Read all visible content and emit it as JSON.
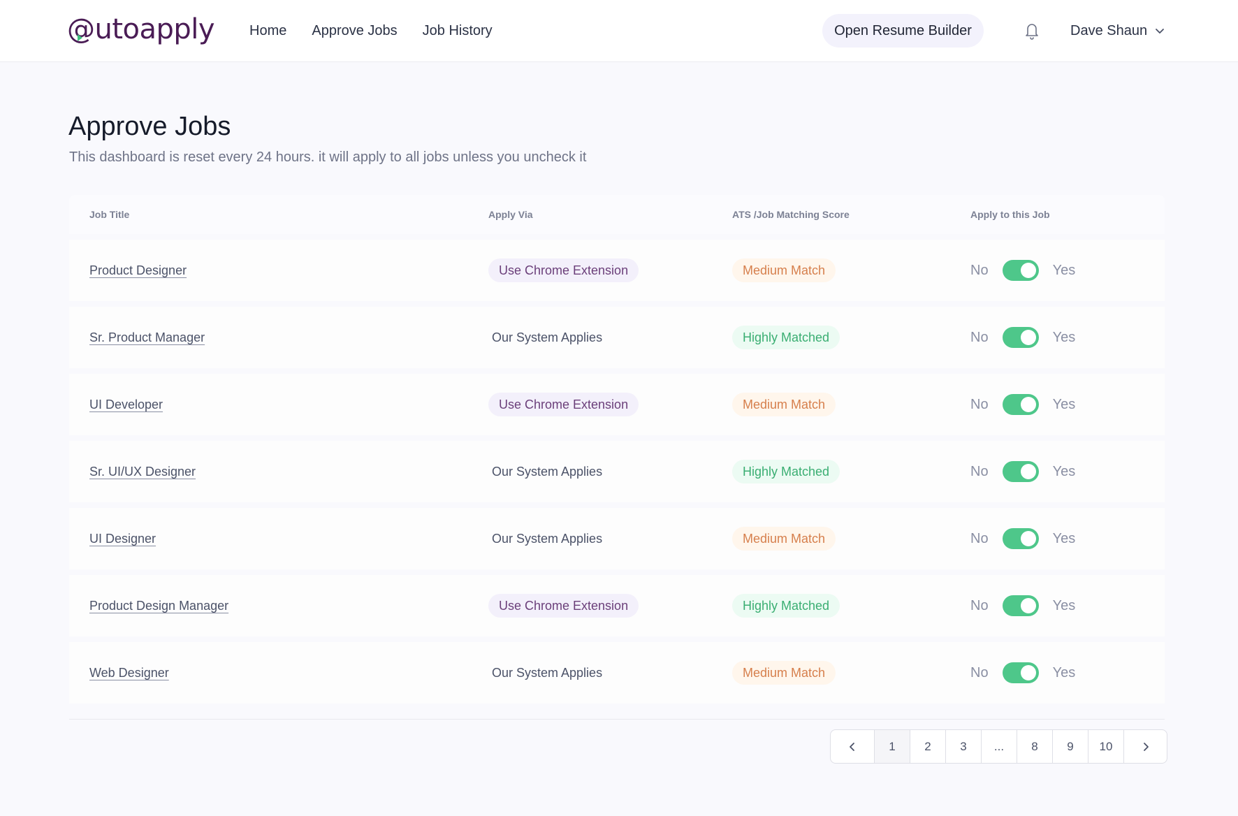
{
  "brand": {
    "logo_text": "@utoapply",
    "logo_color": "#4a1c55",
    "accent_color": "#3fbf7f"
  },
  "nav": {
    "items": [
      {
        "label": "Home"
      },
      {
        "label": "Approve Jobs"
      },
      {
        "label": "Job History"
      }
    ],
    "resume_button": "Open Resume Builder",
    "notification_icon": "bell-icon",
    "user_name": "Dave Shaun",
    "user_menu_icon": "chevron-down-icon"
  },
  "page": {
    "title": "Approve Jobs",
    "subtitle": "This dashboard is reset every 24 hours. it will apply to all jobs unless you uncheck it"
  },
  "table": {
    "columns": [
      "Job Title",
      "Apply Via",
      "ATS /Job Matching Score",
      "Apply to this Job"
    ],
    "toggle_no": "No",
    "toggle_yes": "Yes",
    "rows": [
      {
        "title": "Product Designer",
        "apply_via": "Use Chrome Extension",
        "via_type": "pill",
        "score": "Medium Match",
        "score_level": "medium",
        "apply": true
      },
      {
        "title": "Sr. Product Manager",
        "apply_via": "Our System Applies",
        "via_type": "text",
        "score": "Highly Matched",
        "score_level": "high",
        "apply": true
      },
      {
        "title": "UI Developer",
        "apply_via": "Use Chrome Extension",
        "via_type": "pill",
        "score": "Medium Match",
        "score_level": "medium",
        "apply": true
      },
      {
        "title": "Sr. UI/UX Designer",
        "apply_via": "Our System Applies",
        "via_type": "text",
        "score": "Highly Matched",
        "score_level": "high",
        "apply": true
      },
      {
        "title": "UI Designer",
        "apply_via": "Our System Applies",
        "via_type": "text",
        "score": "Medium Match",
        "score_level": "medium",
        "apply": true
      },
      {
        "title": "Product Design Manager",
        "apply_via": "Use Chrome Extension",
        "via_type": "pill",
        "score": "Highly Matched",
        "score_level": "high",
        "apply": true
      },
      {
        "title": "Web Designer",
        "apply_via": "Our System Applies",
        "via_type": "text",
        "score": "Medium Match",
        "score_level": "medium",
        "apply": true
      }
    ]
  },
  "pagination": {
    "prev_icon": "chevron-left-icon",
    "next_icon": "chevron-right-icon",
    "pages": [
      "1",
      "2",
      "3",
      "...",
      "8",
      "9",
      "10"
    ],
    "current": "1"
  },
  "colors": {
    "toggle_on": "#4ec78a",
    "medium_text": "#d67f4c",
    "medium_bg": "#fff6ec",
    "high_text": "#3aae72",
    "high_bg": "#ecfbf3",
    "chrome_pill_bg": "#f3f0fb",
    "chrome_pill_text": "#6b3f7a"
  }
}
